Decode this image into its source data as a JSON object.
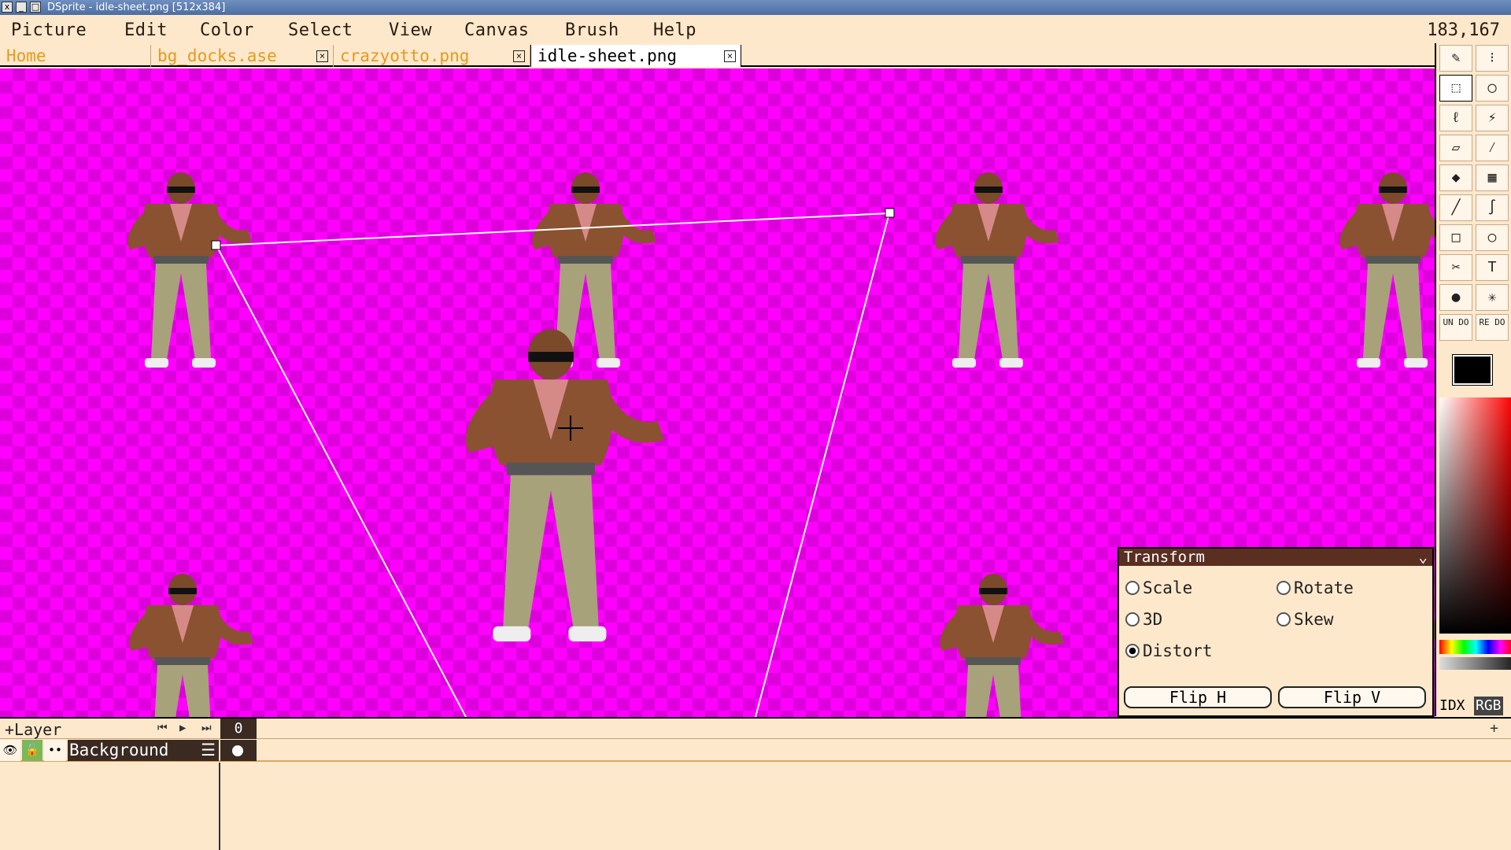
{
  "window": {
    "title": "DSprite - idle-sheet.png [512x384]",
    "buttons": [
      "x",
      "_",
      "□"
    ]
  },
  "menu": {
    "items": [
      "Picture",
      "Edit",
      "Color",
      "Select",
      "View",
      "Canvas",
      "Brush",
      "Help"
    ],
    "coords": "183,167"
  },
  "tabs": [
    {
      "label": "Home"
    },
    {
      "label": "bg_docks.ase"
    },
    {
      "label": "crazyotto.png"
    },
    {
      "label": "idle-sheet.png"
    }
  ],
  "tools": {
    "icons": [
      "pencil-icon",
      "spray-icon",
      "rect-select-icon",
      "ellipse-select-icon",
      "lasso-icon",
      "magic-wand-icon",
      "eraser-icon",
      "eyedropper-icon",
      "fill-icon",
      "gradient-icon",
      "line-icon",
      "curve-icon",
      "rectangle-icon",
      "ellipse-icon",
      "slice-icon",
      "text-icon",
      "blur-icon",
      "jumble-icon",
      "undo-icon",
      "redo-icon"
    ],
    "undo_label": "UN DO",
    "redo_label": "RE DO",
    "text_glyph": "T",
    "color_modes": [
      "IDX",
      "RGB"
    ],
    "fg_color": "#000000"
  },
  "transform": {
    "title": "Transform",
    "options": [
      {
        "label": "Scale",
        "selected": false
      },
      {
        "label": "Rotate",
        "selected": false
      },
      {
        "label": "3D",
        "selected": false
      },
      {
        "label": "Skew",
        "selected": false
      },
      {
        "label": "Distort",
        "selected": true
      }
    ],
    "flip_h": "Flip H",
    "flip_v": "Flip V"
  },
  "timeline": {
    "add_layer": "+Layer",
    "frame": "0",
    "layer_name": "Background",
    "add_frame": "+"
  },
  "colors": {
    "accent_inactive_tab": "#e59a1a",
    "canvas_bg": "#ff00ff",
    "panel_bg": "#fde8cc",
    "dark": "#3b2a22"
  }
}
